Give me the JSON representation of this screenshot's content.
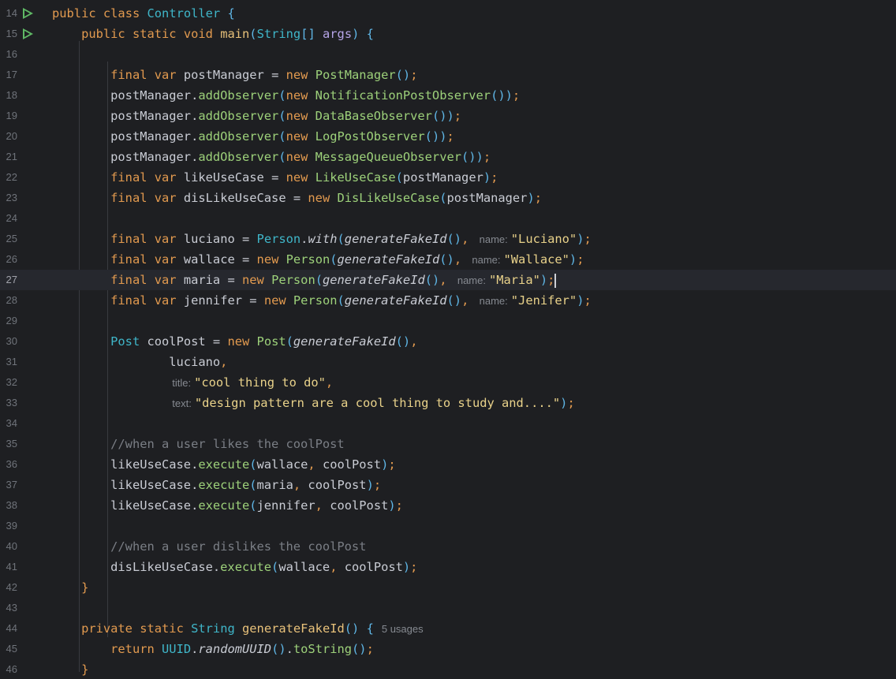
{
  "editor": {
    "lines": [
      {
        "num": "14"
      },
      {
        "num": "15"
      },
      {
        "num": "16"
      },
      {
        "num": "17"
      },
      {
        "num": "18"
      },
      {
        "num": "19"
      },
      {
        "num": "20"
      },
      {
        "num": "21"
      },
      {
        "num": "22"
      },
      {
        "num": "23"
      },
      {
        "num": "24"
      },
      {
        "num": "25"
      },
      {
        "num": "26"
      },
      {
        "num": "27"
      },
      {
        "num": "28"
      },
      {
        "num": "29"
      },
      {
        "num": "30"
      },
      {
        "num": "31"
      },
      {
        "num": "32"
      },
      {
        "num": "33"
      },
      {
        "num": "34"
      },
      {
        "num": "35"
      },
      {
        "num": "36"
      },
      {
        "num": "37"
      },
      {
        "num": "38"
      },
      {
        "num": "39"
      },
      {
        "num": "40"
      },
      {
        "num": "41"
      },
      {
        "num": "42"
      },
      {
        "num": "43"
      },
      {
        "num": "44"
      },
      {
        "num": "45"
      },
      {
        "num": "46"
      }
    ],
    "tokens": {
      "public": "public",
      "class": "class",
      "static": "static",
      "void": "void",
      "final": "final",
      "var": "var",
      "new": "new",
      "private": "private",
      "return": "return",
      "Controller": "Controller",
      "main": "main",
      "String": "String",
      "args": "args",
      "postManager": "postManager",
      "PostManager": "PostManager",
      "addObserver": "addObserver",
      "NotificationPostObserver": "NotificationPostObserver",
      "DataBaseObserver": "DataBaseObserver",
      "LogPostObserver": "LogPostObserver",
      "MessageQueueObserver": "MessageQueueObserver",
      "likeUseCase": "likeUseCase",
      "LikeUseCase": "LikeUseCase",
      "disLikeUseCase": "disLikeUseCase",
      "DisLikeUseCase": "DisLikeUseCase",
      "luciano": "luciano",
      "wallace": "wallace",
      "maria": "maria",
      "jennifer": "jennifer",
      "Person": "Person",
      "with": "with",
      "generateFakeId": "generateFakeId",
      "name_hint": "name:",
      "title_hint": "title:",
      "text_hint": "text:",
      "s_luciano": "\"Luciano\"",
      "s_wallace": "\"Wallace\"",
      "s_maria": "\"Maria\"",
      "s_jenifer": "\"Jenifer\"",
      "Post": "Post",
      "coolPost": "coolPost",
      "s_title": "\"cool thing to do\"",
      "s_text": "\"design pattern are a cool thing to study and....\"",
      "comment_likes": "//when a user likes the coolPost",
      "comment_dislikes": "//when a user dislikes the coolPost",
      "execute": "execute",
      "UUID": "UUID",
      "randomUUID": "randomUUID",
      "toString": "toString",
      "usages": "5 usages"
    }
  },
  "colors": {
    "background": "#1e1f22",
    "current_line": "#26282e",
    "keyword": "#e29a4f",
    "string": "#e9d28a",
    "run_icon": "#5fb865"
  }
}
